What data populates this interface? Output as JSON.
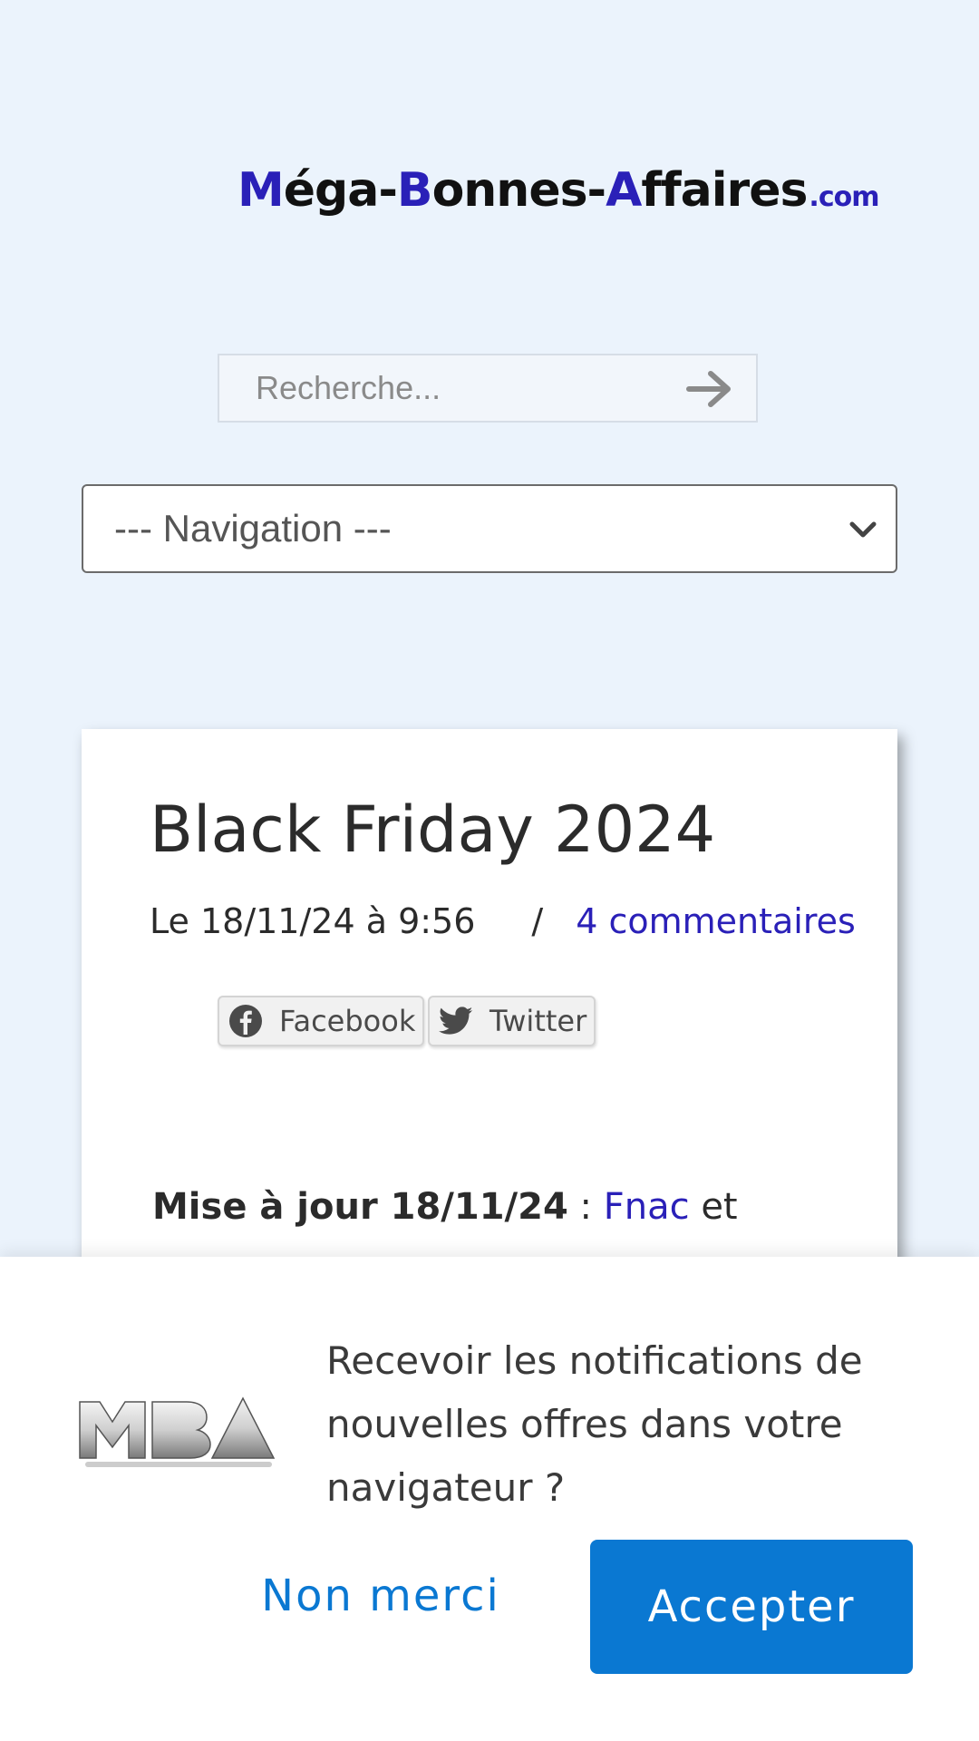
{
  "header": {
    "logo": {
      "part1_m": "M",
      "part1_rest": "éga-",
      "part2_b": "B",
      "part2_rest": "onnes-",
      "part3_a": "A",
      "part3_rest": "ffaires",
      "tld": ".com"
    }
  },
  "search": {
    "placeholder": "Recherche...",
    "icon": "arrow-right-icon"
  },
  "navigation": {
    "selected": "--- Navigation ---",
    "icon": "chevron-down-icon"
  },
  "article": {
    "title": "Black Friday 2024",
    "date": "Le 18/11/24 à 9:56",
    "separator": "/",
    "comments_link": "4 commentaires",
    "share": {
      "facebook_label": "Facebook",
      "twitter_label": "Twitter"
    },
    "update": {
      "bold": "Mise à jour 18/11/24",
      "colon": " : ",
      "link": "Fnac",
      "tail": " et"
    }
  },
  "notification": {
    "logo_alt": "MBA",
    "message": "Recevoir les notifications de nouvelles offres dans votre navigateur ?",
    "decline_label": "Non merci",
    "accept_label": "Accepter"
  },
  "colors": {
    "page_bg": "#ebf3fc",
    "brand_blue": "#2a20b8",
    "accept_blue": "#0a78d2"
  }
}
